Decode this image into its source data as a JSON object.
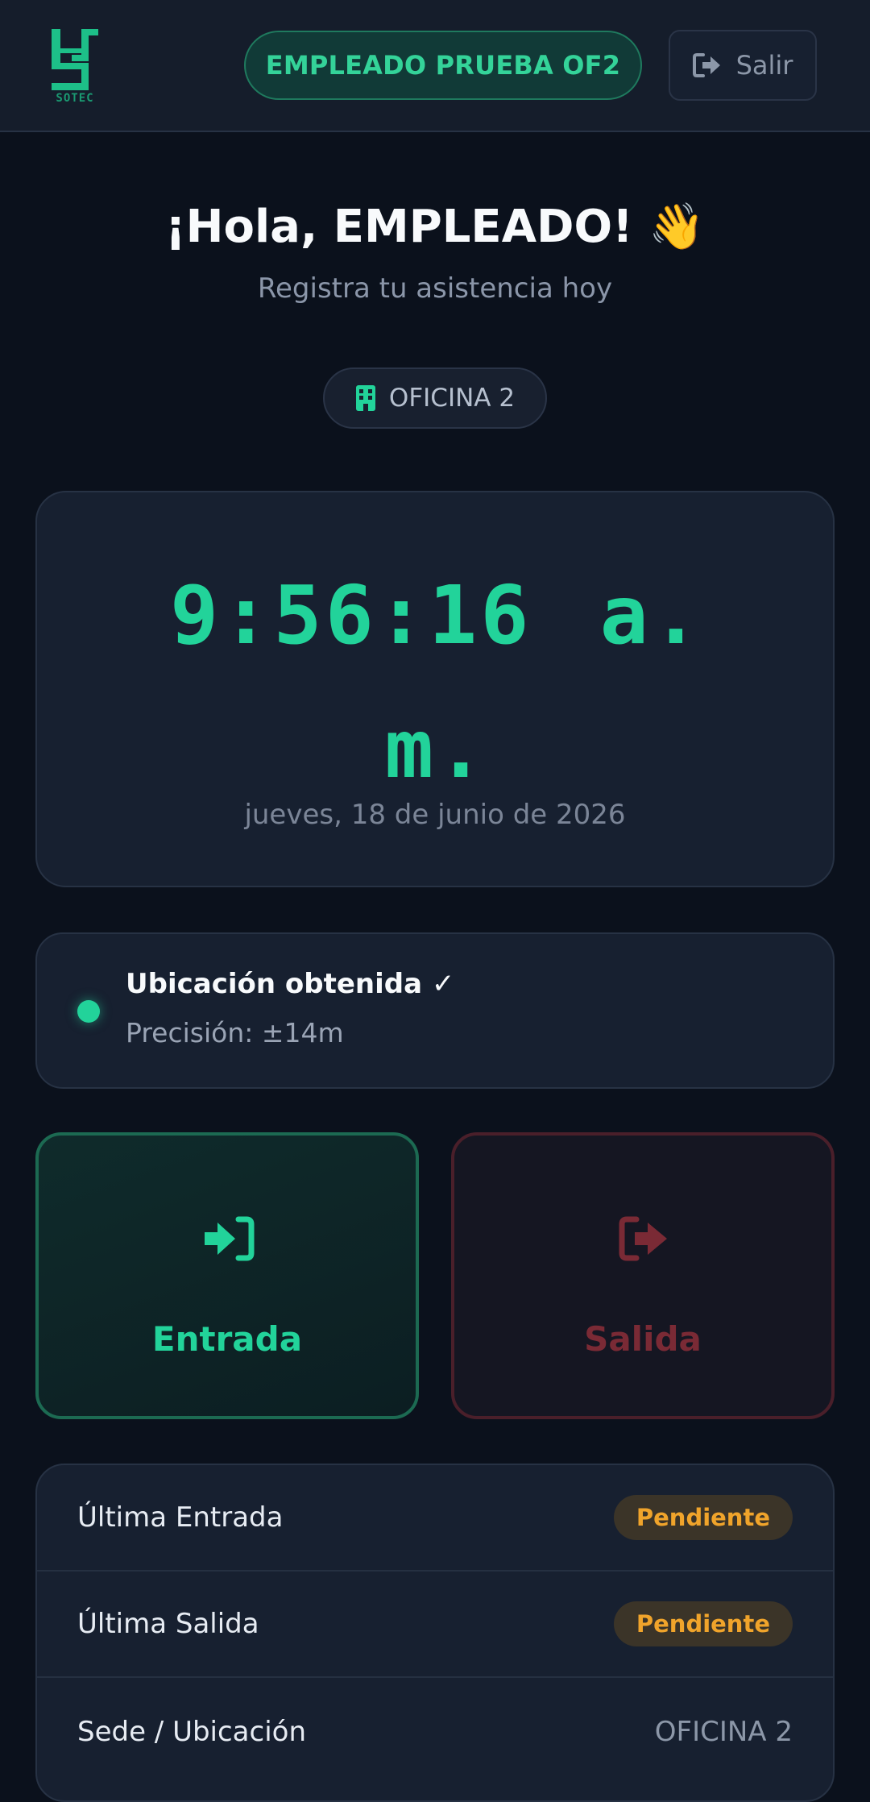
{
  "header": {
    "logo_text": "SOTEC",
    "user_name": "EMPLEADO PRUEBA OF2",
    "logout_label": "Salir",
    "logout_icon": "sign-out-icon"
  },
  "greeting": {
    "title": "¡Hola, EMPLEADO! 👋",
    "subtitle": "Registra tu asistencia hoy"
  },
  "office": {
    "icon": "building-icon",
    "label": "OFICINA 2"
  },
  "clock": {
    "time": "9:56:16 a. m.",
    "date": "jueves, 18 de junio de 2026"
  },
  "location": {
    "status": "Ubicación obtenida ✓",
    "accuracy": "Precisión: ±14m",
    "status_color": "#22d39a"
  },
  "actions": {
    "entry": {
      "label": "Entrada",
      "icon": "sign-in-icon",
      "color": "#22d39a"
    },
    "exit": {
      "label": "Salida",
      "icon": "sign-out-icon",
      "color": "#7a2a35"
    }
  },
  "summary": {
    "rows": [
      {
        "label": "Última Entrada",
        "value": "Pendiente"
      },
      {
        "label": "Última Salida",
        "value": "Pendiente"
      },
      {
        "label": "Sede / Ubicación",
        "value": "OFICINA 2"
      }
    ]
  },
  "colors": {
    "accent": "#22d39a",
    "pending": "#f0a42b",
    "background": "#0b111c",
    "card": "#172030"
  }
}
